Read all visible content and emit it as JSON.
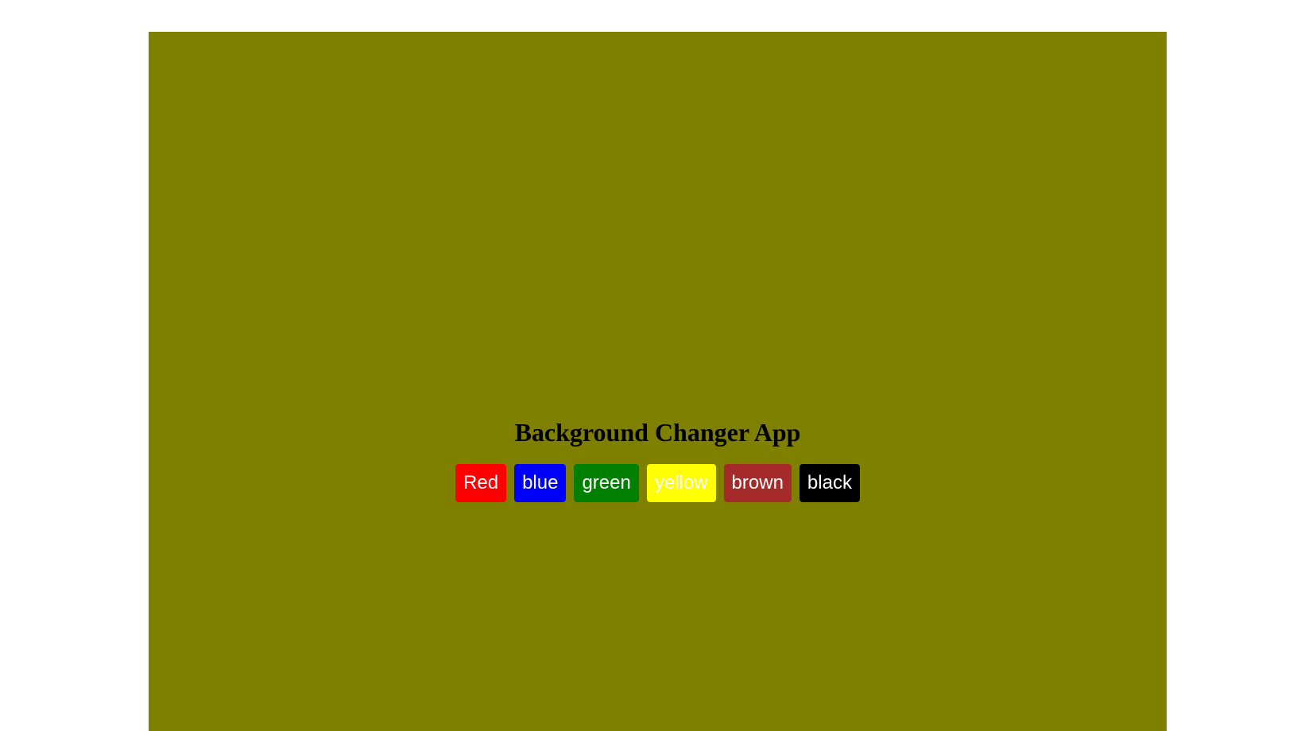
{
  "app": {
    "title": "Background Changer App",
    "background_color": "#808000"
  },
  "buttons": [
    {
      "label": "Red",
      "color": "#ff0000"
    },
    {
      "label": "blue",
      "color": "#0000ff"
    },
    {
      "label": "green",
      "color": "#008000"
    },
    {
      "label": "yellow",
      "color": "#ffff00"
    },
    {
      "label": "brown",
      "color": "#a52a2a"
    },
    {
      "label": "black",
      "color": "#000000"
    }
  ]
}
